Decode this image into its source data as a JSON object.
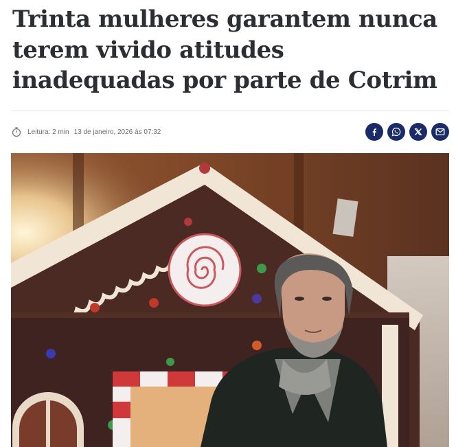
{
  "article": {
    "headline": "Trinta mulheres garantem nunca terem vivido atitudes inadequadas por parte de Cotrim",
    "reading_time": "Leitura: 2 min",
    "date": "13 de janeiro, 2026 às 07:32"
  },
  "share": {
    "buttons": [
      {
        "name": "facebook",
        "icon": "facebook-icon"
      },
      {
        "name": "whatsapp",
        "icon": "whatsapp-icon"
      },
      {
        "name": "x",
        "icon": "x-icon"
      },
      {
        "name": "email",
        "icon": "mail-icon"
      }
    ],
    "color": "#1a2b6a"
  },
  "photo": {
    "subject": "man-in-front-of-gingerbread-house"
  }
}
